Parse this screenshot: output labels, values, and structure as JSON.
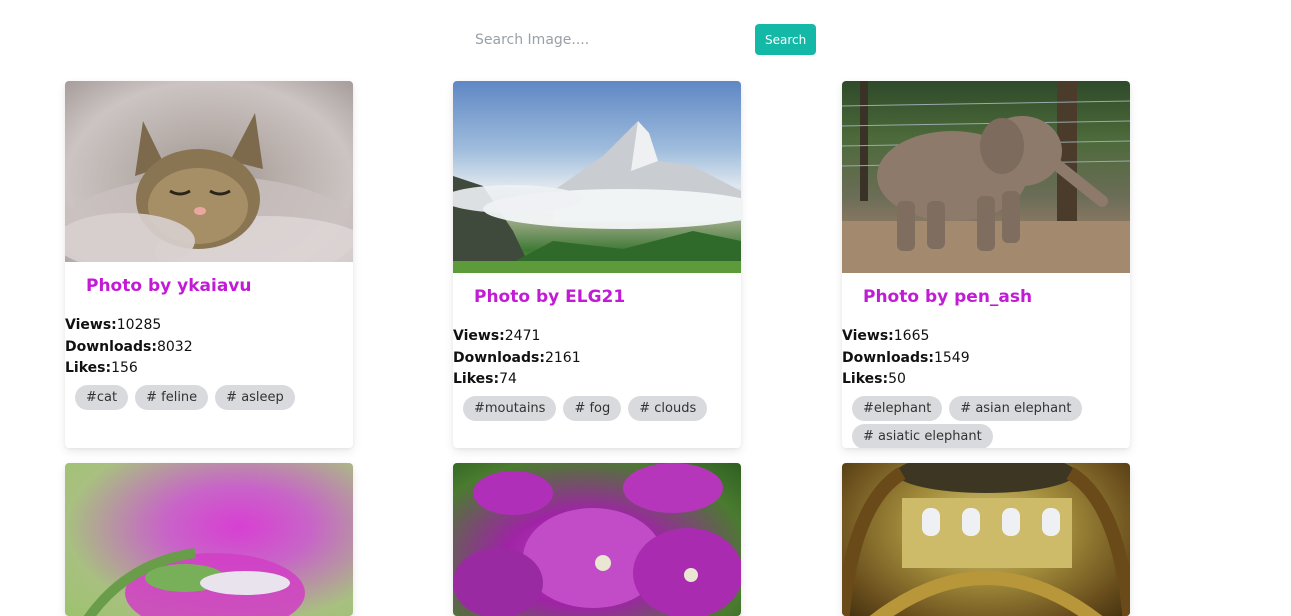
{
  "search": {
    "placeholder": "Search Image....",
    "button_label": "Search"
  },
  "labels": {
    "views": "Views:",
    "downloads": "Downloads:",
    "likes": "Likes:"
  },
  "cards": [
    {
      "title": "Photo by ykaiavu",
      "views": "10285",
      "downloads": "8032",
      "likes": "156",
      "tags": [
        "#cat",
        "# feline",
        "# asleep"
      ]
    },
    {
      "title": "Photo by ELG21",
      "views": "2471",
      "downloads": "2161",
      "likes": "74",
      "tags": [
        "#moutains",
        "# fog",
        "# clouds"
      ]
    },
    {
      "title": "Photo by pen_ash",
      "views": "1665",
      "downloads": "1549",
      "likes": "50",
      "tags": [
        "#elephant",
        "# asian elephant",
        "# asiatic elephant"
      ]
    }
  ],
  "colors": {
    "accent": "#14b8a6",
    "title": "#c21bd6",
    "tag_bg": "#d9dadd"
  }
}
